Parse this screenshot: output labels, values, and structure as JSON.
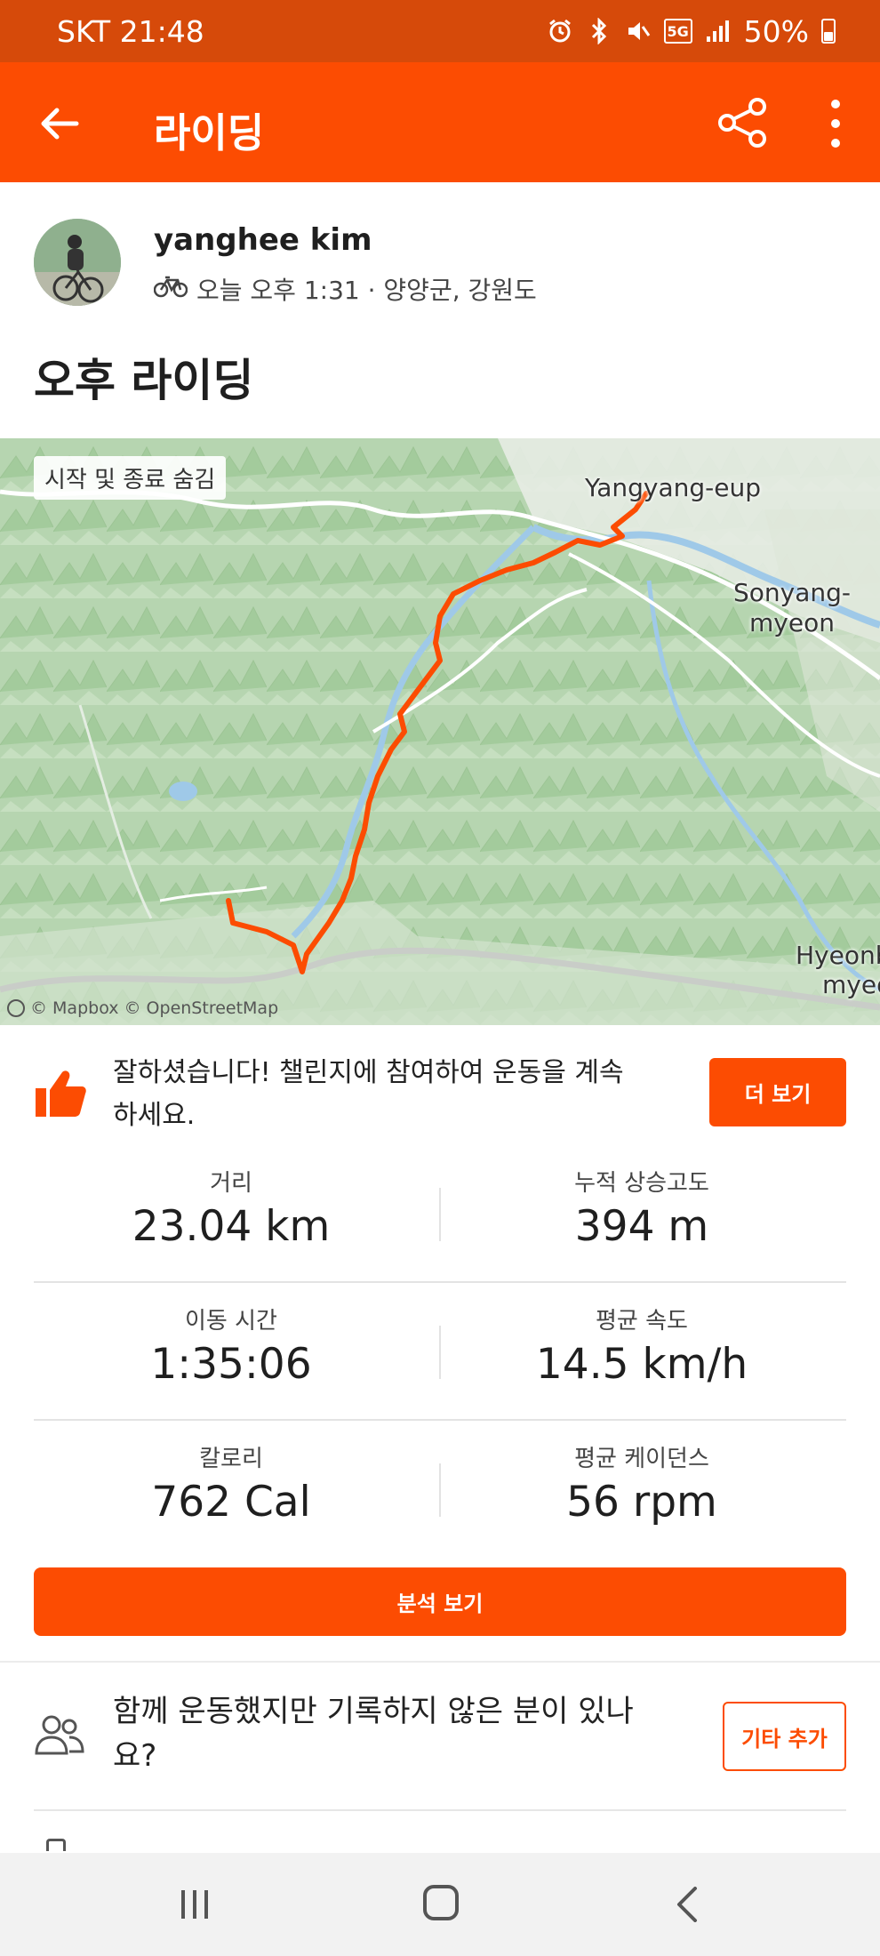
{
  "status_bar": {
    "carrier_time": "SKT 21:48",
    "network": "5G",
    "battery": "50%",
    "icons": [
      "alarm-icon",
      "bluetooth-icon",
      "mute-icon",
      "5g-icon",
      "signal-icon",
      "battery-icon"
    ]
  },
  "app_bar": {
    "title": "라이딩",
    "back_icon": "back-arrow-icon",
    "share_icon": "share-icon",
    "more_icon": "more-vert-icon"
  },
  "athlete": {
    "name": "yanghee kim",
    "meta": "오늘 오후 1:31 · 양양군, 강원도",
    "sport_icon": "bicycle-icon"
  },
  "activity": {
    "title": "오후 라이딩"
  },
  "map": {
    "hide_start_end": "시작 및 종료 숨김",
    "labels": {
      "town": "Yangyang-eup",
      "sonyang_1": "Sonyang-",
      "sonyang_2": "myeon",
      "hyeon_1": "Hyeonb",
      "hyeon_2": "myeo"
    },
    "attribution": "© Mapbox © OpenStreetMap",
    "route_color": "#fc4c02"
  },
  "kudos": {
    "text": "잘하셨습니다! 챌린지에 참여하여 운동을 계속하세요.",
    "button": "더 보기"
  },
  "stats": {
    "distance_label": "거리",
    "distance_value": "23.04 km",
    "elevation_label": "누적 상승고도",
    "elevation_value": "394 m",
    "moving_time_label": "이동 시간",
    "moving_time_value": "1:35:06",
    "avg_speed_label": "평균 속도",
    "avg_speed_value": "14.5 km/h",
    "calories_label": "칼로리",
    "calories_value": "762 Cal",
    "avg_cadence_label": "평균 케이던스",
    "avg_cadence_value": "56 rpm"
  },
  "analysis": {
    "button": "분석 보기"
  },
  "group": {
    "text": "함께 운동했지만 기록하지 않은 분이 있나요?",
    "button": "기타 추가"
  },
  "colors": {
    "brand": "#fc4c02",
    "status_bar": "#d64a0a"
  }
}
